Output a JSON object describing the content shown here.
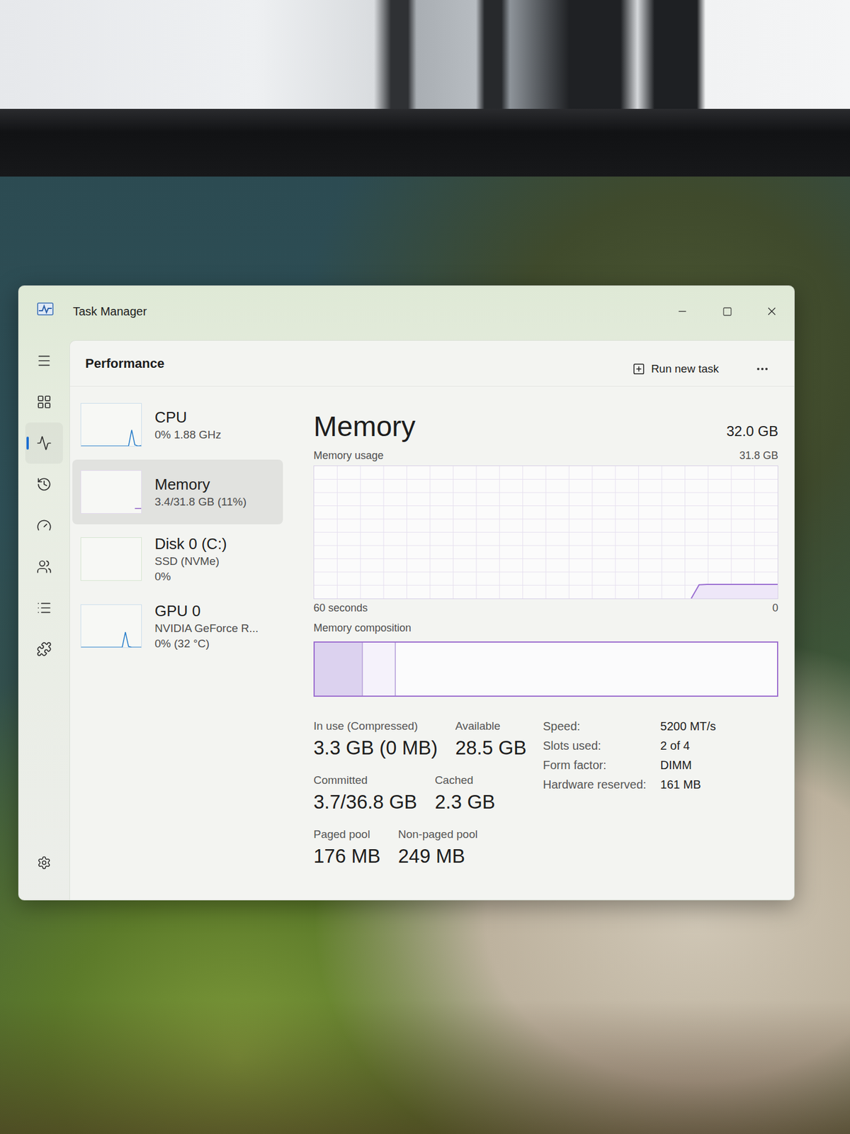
{
  "window": {
    "title": "Task Manager"
  },
  "nav": {
    "items": [
      {
        "selected": false
      },
      {
        "selected": false
      },
      {
        "selected": true
      },
      {
        "selected": false
      },
      {
        "selected": false
      },
      {
        "selected": false
      },
      {
        "selected": false
      },
      {
        "selected": false
      }
    ],
    "settings": {
      "selected": false
    }
  },
  "header": {
    "title": "Performance",
    "action": "Run new task"
  },
  "devices": [
    {
      "name": "CPU",
      "lines": [
        "0% 1.88 GHz"
      ],
      "selected": false,
      "color": "#1f78c8",
      "values": [
        0,
        0,
        0,
        0,
        0,
        0,
        0,
        0,
        0,
        0,
        0,
        0,
        0,
        0,
        0,
        0,
        0.38,
        0.03,
        0,
        0.01
      ]
    },
    {
      "name": "Memory",
      "lines": [
        "3.4/31.8 GB (11%)"
      ],
      "selected": true,
      "color": "#8a5cc4",
      "values": [
        0.11,
        0.11,
        0.11
      ]
    },
    {
      "name": "Disk 0 (C:)",
      "lines": [
        "SSD (NVMe)",
        "0%"
      ],
      "selected": false,
      "color": "#4a9a3a",
      "values": []
    },
    {
      "name": "GPU 0",
      "lines": [
        "NVIDIA GeForce R...",
        "0% (32 °C)"
      ],
      "selected": false,
      "color": "#1f78c8",
      "values": [
        0,
        0,
        0,
        0,
        0,
        0,
        0,
        0,
        0,
        0,
        0,
        0,
        0,
        0,
        0.36,
        0.02,
        0,
        0,
        0,
        0
      ]
    }
  ],
  "memory": {
    "title": "Memory",
    "capacity": "32.0 GB",
    "usage_label": "Memory usage",
    "max_label": "31.8 GB",
    "time_label": "60 seconds",
    "min_label": "0",
    "chart": {
      "max": 31.8,
      "values": [
        0,
        3.3,
        3.4,
        3.4,
        3.4,
        3.4,
        3.4,
        3.4,
        3.4,
        3.4,
        3.4,
        3.4
      ]
    },
    "composition_label": "Memory composition",
    "composition": [
      {
        "level": 0.104,
        "color": "#dcd2ef"
      },
      {
        "level": 0.072,
        "color": "#f5f2fb"
      }
    ],
    "stats": [
      [
        {
          "label": "In use (Compressed)",
          "value": "3.3 GB (0 MB)"
        },
        {
          "label": "Available",
          "value": "28.5 GB"
        }
      ],
      [
        {
          "label": "Committed",
          "value": "3.7/36.8 GB"
        },
        {
          "label": "Cached",
          "value": "2.3 GB"
        }
      ],
      [
        {
          "label": "Paged pool",
          "value": "176 MB"
        },
        {
          "label": "Non-paged pool",
          "value": "249 MB"
        }
      ]
    ],
    "details": [
      {
        "key": "Speed:",
        "value": "5200 MT/s"
      },
      {
        "key": "Slots used:",
        "value": "2 of 4"
      },
      {
        "key": "Form factor:",
        "value": "DIMM"
      },
      {
        "key": "Hardware reserved:",
        "value": "161 MB"
      }
    ]
  }
}
